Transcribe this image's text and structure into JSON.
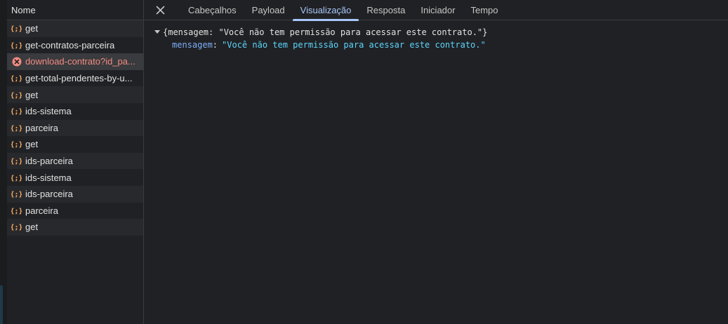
{
  "list": {
    "header": "Nome",
    "rows": [
      {
        "label": "get",
        "icon": "json-icon",
        "status": "ok"
      },
      {
        "label": "get-contratos-parceira",
        "icon": "json-icon",
        "status": "ok"
      },
      {
        "label": "download-contrato?id_pa...",
        "icon": "error-icon",
        "status": "error"
      },
      {
        "label": "get-total-pendentes-by-u...",
        "icon": "json-icon",
        "status": "ok"
      },
      {
        "label": "get",
        "icon": "json-icon",
        "status": "ok"
      },
      {
        "label": "ids-sistema",
        "icon": "json-icon",
        "status": "ok"
      },
      {
        "label": "parceira",
        "icon": "json-icon",
        "status": "ok"
      },
      {
        "label": "get",
        "icon": "json-icon",
        "status": "ok"
      },
      {
        "label": "ids-parceira",
        "icon": "json-icon",
        "status": "ok"
      },
      {
        "label": "ids-sistema",
        "icon": "json-icon",
        "status": "ok"
      },
      {
        "label": "ids-parceira",
        "icon": "json-icon",
        "status": "ok"
      },
      {
        "label": "parceira",
        "icon": "json-icon",
        "status": "ok"
      },
      {
        "label": "get",
        "icon": "json-icon",
        "status": "ok"
      }
    ]
  },
  "tabs": [
    {
      "label": "Cabeçalhos",
      "active": false
    },
    {
      "label": "Payload",
      "active": false
    },
    {
      "label": "Visualização",
      "active": true
    },
    {
      "label": "Resposta",
      "active": false
    },
    {
      "label": "Iniciador",
      "active": false
    },
    {
      "label": "Tempo",
      "active": false
    }
  ],
  "preview": {
    "summary": "{mensagem: \"Você não tem permissão para acessar este contrato.\"}",
    "key": "mensagem",
    "colon": ":",
    "value": "\"Você não tem permissão para acessar este contrato.\""
  },
  "colors": {
    "accent": "#a8c7fa",
    "error": "#f28b82",
    "json_icon": "#f9ab61",
    "json_key": "#7cacf8",
    "json_string": "#5cd5fb"
  }
}
